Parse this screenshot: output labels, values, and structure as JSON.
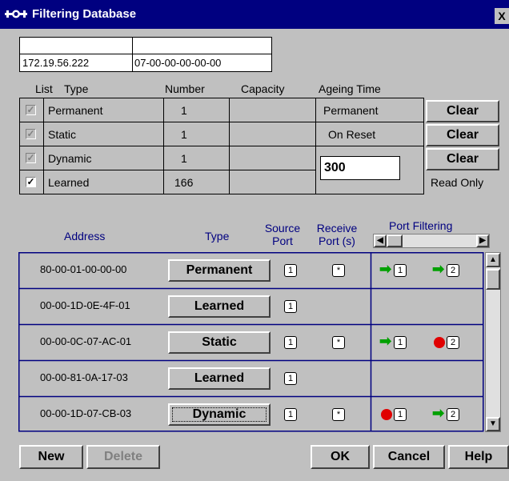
{
  "window": {
    "title": "Filtering Database",
    "close_label": "X"
  },
  "info": {
    "ip": "172.19.56.222",
    "mac": "07-00-00-00-00-00"
  },
  "summary": {
    "headers": {
      "list": "List",
      "type": "Type",
      "number": "Number",
      "capacity": "Capacity",
      "ageing": "Ageing Time"
    },
    "rows": [
      {
        "checked": true,
        "enabled": false,
        "type": "Permanent",
        "number": "1",
        "ageing": "Permanent",
        "action": "Clear"
      },
      {
        "checked": true,
        "enabled": false,
        "type": "Static",
        "number": "1",
        "ageing": "On Reset",
        "action": "Clear"
      },
      {
        "checked": true,
        "enabled": false,
        "type": "Dynamic",
        "number": "1",
        "ageing_input": "300",
        "action": "Clear"
      },
      {
        "checked": true,
        "enabled": true,
        "type": "Learned",
        "number": "166",
        "action_text": "Read Only"
      }
    ]
  },
  "table": {
    "headers": {
      "address": "Address",
      "type": "Type",
      "source_port": "Source Port",
      "receive_port": "Receive Port (s)",
      "port_filtering": "Port Filtering"
    },
    "rows": [
      {
        "address": "80-00-01-00-00-00",
        "type": "Permanent",
        "source": "1",
        "receive": "*",
        "filter": [
          {
            "icon": "green-arrow-icon",
            "port": "1"
          },
          {
            "icon": "green-arrow-icon",
            "port": "2"
          }
        ]
      },
      {
        "address": "00-00-1D-0E-4F-01",
        "type": "Learned",
        "source": "1",
        "receive": "",
        "filter": []
      },
      {
        "address": "00-00-0C-07-AC-01",
        "type": "Static",
        "source": "1",
        "receive": "*",
        "filter": [
          {
            "icon": "green-arrow-icon",
            "port": "1"
          },
          {
            "icon": "red-dot-icon",
            "port": "2"
          }
        ]
      },
      {
        "address": "00-00-81-0A-17-03",
        "type": "Learned",
        "source": "1",
        "receive": "",
        "filter": []
      },
      {
        "address": "00-00-1D-07-CB-03",
        "type": "Dynamic",
        "source": "1",
        "receive": "*",
        "filter": [
          {
            "icon": "red-dot-icon",
            "port": "1"
          },
          {
            "icon": "green-arrow-icon",
            "port": "2"
          }
        ]
      }
    ]
  },
  "footer": {
    "new": "New",
    "delete": "Delete",
    "ok": "OK",
    "cancel": "Cancel",
    "help": "Help"
  },
  "colors": {
    "titlebar": "#000080",
    "accent_green": "#00a000",
    "accent_red": "#e00000"
  }
}
